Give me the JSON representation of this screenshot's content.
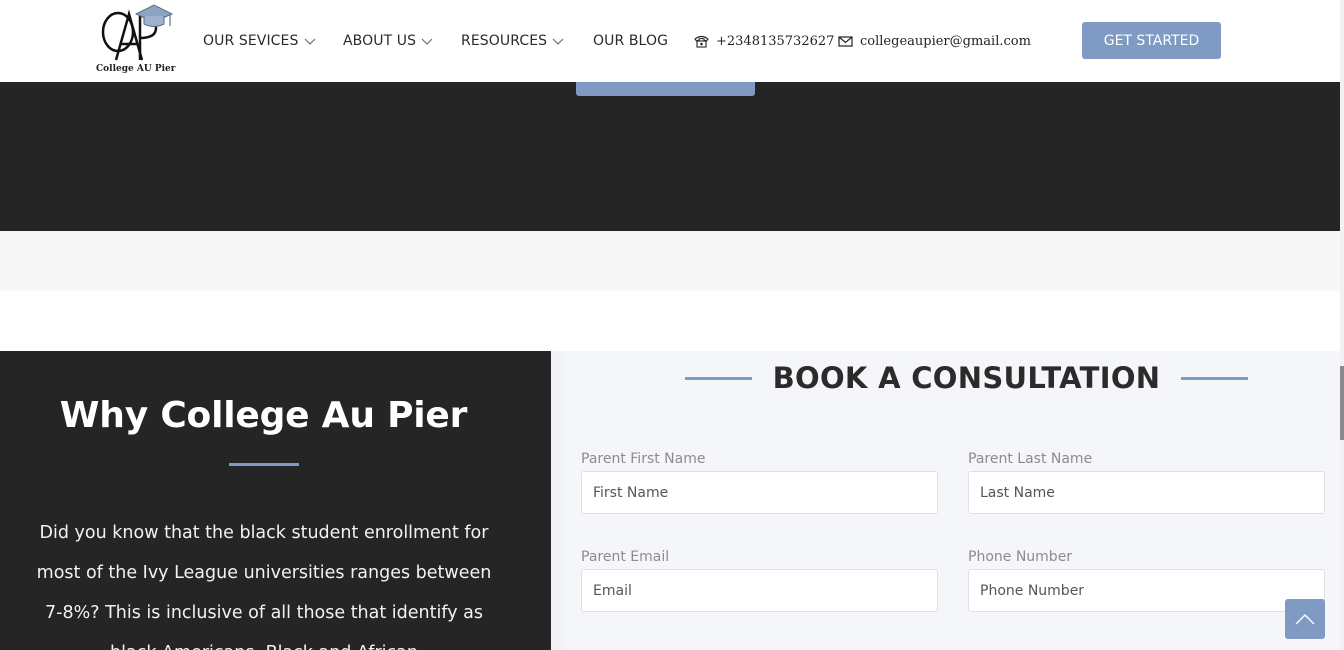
{
  "header": {
    "logo_text": "College AU Pier",
    "nav": [
      {
        "label": "OUR SEVICES",
        "has_dropdown": true
      },
      {
        "label": "ABOUT US",
        "has_dropdown": true
      },
      {
        "label": "RESOURCES",
        "has_dropdown": true
      },
      {
        "label": "OUR BLOG",
        "has_dropdown": false
      }
    ],
    "phone": "+2348135732627",
    "email": "collegeaupier@gmail.com",
    "cta_label": "GET STARTED"
  },
  "why": {
    "title": "Why College Au Pier",
    "body": "Did you know that the black student enrollment for most of the Ivy League universities ranges between 7-8%? This is inclusive of all those that identify as black Americans, Black and African"
  },
  "form": {
    "title": "BOOK A CONSULTATION",
    "fields": [
      {
        "label": "Parent First Name",
        "placeholder": "First Name"
      },
      {
        "label": "Parent Last Name",
        "placeholder": "Last Name"
      },
      {
        "label": "Parent Email",
        "placeholder": "Email"
      },
      {
        "label": "Phone Number",
        "placeholder": "Phone Number"
      }
    ]
  },
  "colors": {
    "accent": "#7f9bc4",
    "dark": "#252526"
  },
  "icons": {
    "phone": "phone-icon",
    "email": "envelope-icon",
    "back_to_top": "chevron-up-icon"
  }
}
